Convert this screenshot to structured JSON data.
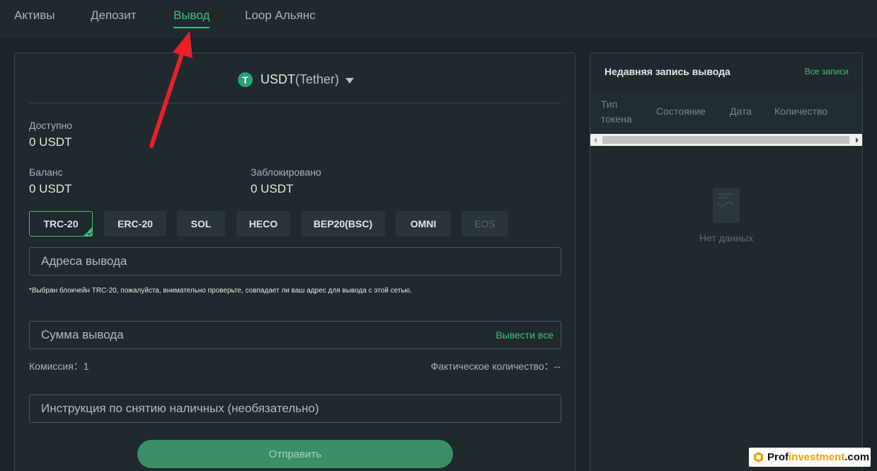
{
  "nav": {
    "tabs": [
      {
        "label": "Активы"
      },
      {
        "label": "Депозит"
      },
      {
        "label": "Вывод",
        "active": true
      },
      {
        "label": "Loop Альянс"
      }
    ]
  },
  "withdraw": {
    "coin_symbol": "USDT",
    "coin_name": "(Tether)",
    "coin_icon_glyph": "T",
    "available_label": "Доступно",
    "available_value": "0 USDT",
    "balance_label": "Баланс",
    "balance_value": "0 USDT",
    "frozen_label": "Заблокировано",
    "frozen_value": "0 USDT",
    "chains": [
      {
        "label": "TRC-20",
        "selected": true
      },
      {
        "label": "ERC-20"
      },
      {
        "label": "SOL"
      },
      {
        "label": "HECO"
      },
      {
        "label": "BEP20(BSC)"
      },
      {
        "label": "OMNI"
      },
      {
        "label": "EOS",
        "disabled": true
      }
    ],
    "address_placeholder": "Адреса вывода",
    "chain_note": "*Выбран блокчейн TRC-20, пожалуйста, внимательно проверьте, совпадает ли ваш адрес для вывода с этой сетью.",
    "amount_placeholder": "Сумма вывода",
    "withdraw_all_label": "Вывести все",
    "fee_text": "Комиссия：1",
    "actual_text": "Фактическое количество：--",
    "memo_placeholder": "Инструкция по снятию наличных (необязательно)",
    "submit_label": "Отправить"
  },
  "recent": {
    "title": "Недавняя запись вывода",
    "all_link": "Все записи",
    "columns": [
      "Тип токена",
      "Состояние",
      "Дата",
      "Количество"
    ],
    "empty_text": "Нет данных"
  },
  "watermark": {
    "brand_prefix": "Prof",
    "brand_highlight": "investment",
    "brand_suffix": ".com"
  },
  "colors": {
    "accent": "#3fbf7f",
    "annotation": "#e8202a"
  }
}
